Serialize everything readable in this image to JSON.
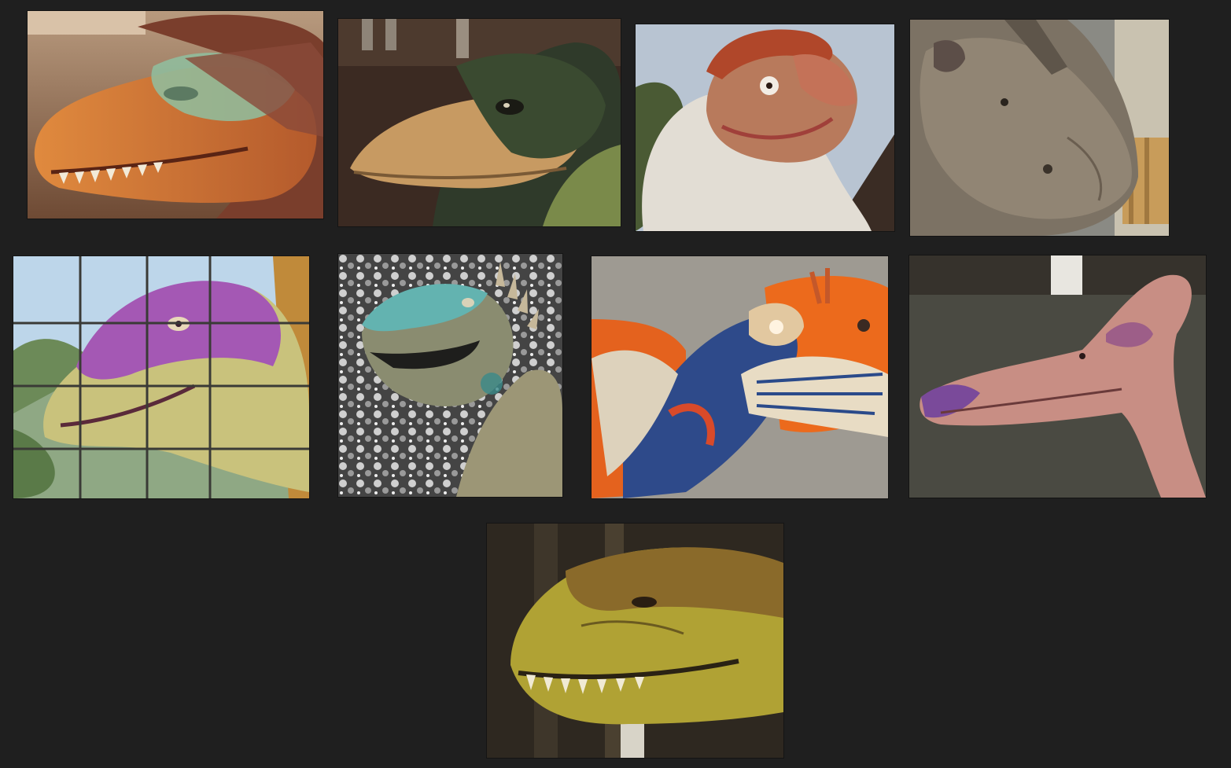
{
  "gallery": {
    "tiles": [
      {
        "icon": "feathered-orange-raptor-head"
      },
      {
        "icon": "dark-feathered-raptor-head"
      },
      {
        "icon": "feathered-red-crested-dinosaur-head"
      },
      {
        "icon": "horned-ceratopsian-head"
      },
      {
        "icon": "purple-sauropod-head"
      },
      {
        "icon": "teal-spined-dinosaur-head"
      },
      {
        "icon": "blue-feathered-winged-dinosaur"
      },
      {
        "icon": "pink-pterosaur-head"
      },
      {
        "icon": "tyrannosaurus-head"
      }
    ]
  },
  "colors": {
    "background": "#1f1f1f"
  }
}
